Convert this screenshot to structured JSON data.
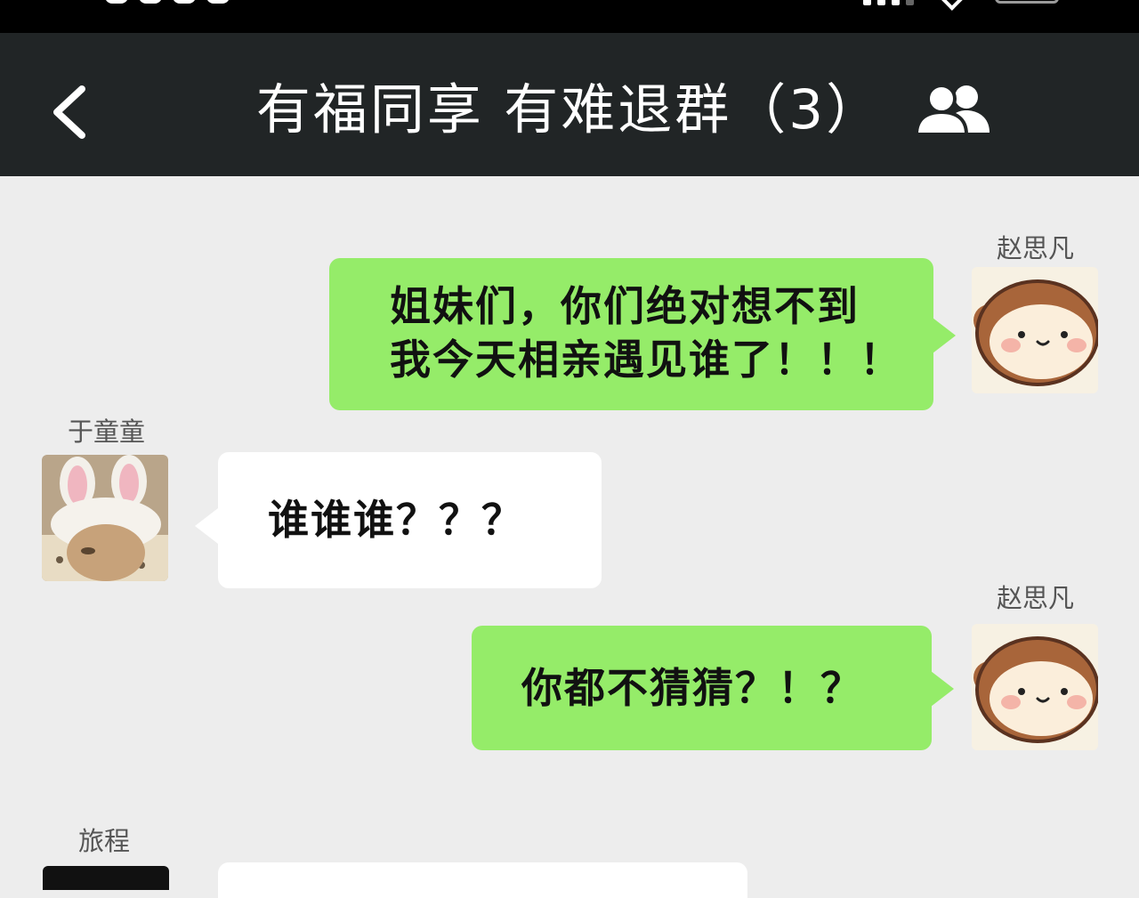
{
  "status_bar": {
    "icons": [
      "signal-icon",
      "wifi-icon",
      "battery-icon"
    ]
  },
  "header": {
    "back_icon": "chevron-left-icon",
    "title": "有福同享 有难退群（3）",
    "members_icon": "group-members-icon"
  },
  "messages": [
    {
      "sender": "赵思凡",
      "direction": "outgoing",
      "avatar": "monkey-avatar",
      "text": "姐妹们，你们绝对想不到\n我今天相亲遇见谁了！！！"
    },
    {
      "sender": "于童童",
      "direction": "incoming",
      "avatar": "bunny-ears-avatar",
      "text": "谁谁谁？？？"
    },
    {
      "sender": "赵思凡",
      "direction": "outgoing",
      "avatar": "monkey-avatar",
      "text": "你都不猜猜？！？"
    },
    {
      "sender": "旅程",
      "direction": "incoming",
      "avatar": "dark-avatar",
      "text": ""
    }
  ],
  "colors": {
    "header_bg": "#212526",
    "chat_bg": "#ededed",
    "outgoing_bubble": "#95ec69",
    "incoming_bubble": "#ffffff"
  }
}
